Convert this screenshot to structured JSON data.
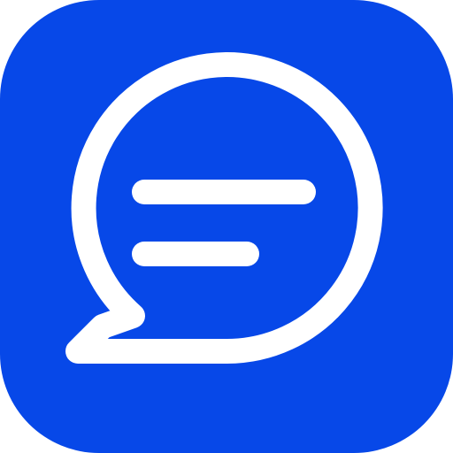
{
  "app_icon": {
    "name": "chat-bubble-icon",
    "background_color": "#0748E8",
    "foreground_color": "#FFFFFF"
  }
}
